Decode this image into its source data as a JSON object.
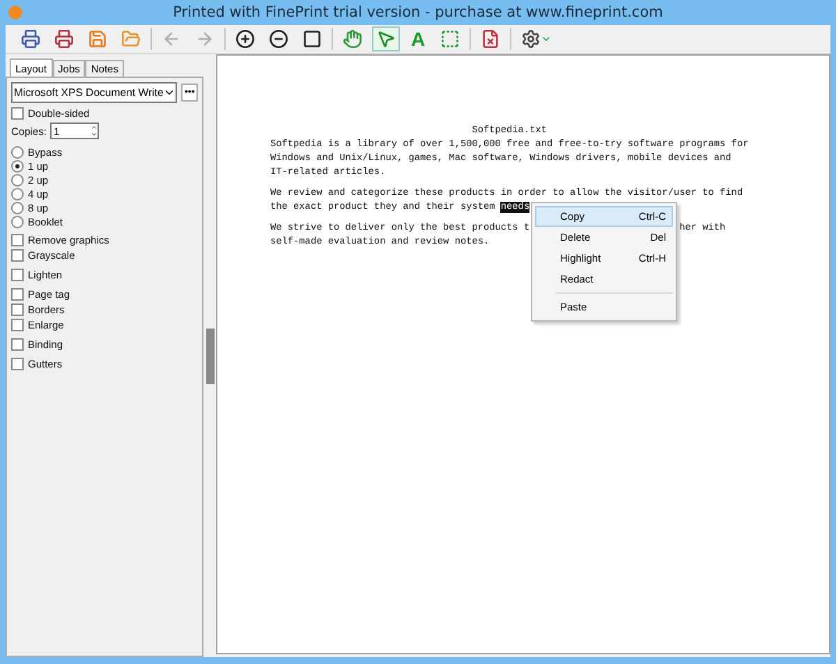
{
  "window": {
    "title": "Printed with FinePrint trial version - purchase at www.fineprint.com"
  },
  "toolbar": [
    {
      "kind": "print",
      "disabled": false,
      "selected": false
    },
    {
      "kind": "print-cancel",
      "disabled": false,
      "selected": false
    },
    {
      "kind": "save",
      "disabled": false,
      "selected": false
    },
    {
      "kind": "open",
      "disabled": false,
      "selected": false
    },
    {
      "kind": "back",
      "disabled": true,
      "selected": false
    },
    {
      "kind": "forward",
      "disabled": true,
      "selected": false
    },
    {
      "kind": "zoom-in",
      "disabled": false,
      "selected": false
    },
    {
      "kind": "zoom-out",
      "disabled": false,
      "selected": false
    },
    {
      "kind": "fit",
      "disabled": false,
      "selected": false
    },
    {
      "kind": "hand",
      "disabled": false,
      "selected": false
    },
    {
      "kind": "pointer",
      "disabled": false,
      "selected": true
    },
    {
      "kind": "text",
      "label": "A",
      "disabled": false,
      "selected": false
    },
    {
      "kind": "marquee",
      "disabled": false,
      "selected": false
    },
    {
      "kind": "delete-page",
      "disabled": false,
      "selected": false
    },
    {
      "kind": "settings",
      "disabled": false,
      "selected": false
    }
  ],
  "tabs": [
    {
      "label": "Layout",
      "selected": true
    },
    {
      "label": "Jobs",
      "selected": false
    },
    {
      "label": "Notes",
      "selected": false
    }
  ],
  "printer": {
    "value": "Microsoft XPS Document Write",
    "more": "•••"
  },
  "double_sided": {
    "label": "Double-sided",
    "checked": false
  },
  "copies": {
    "label": "Copies:",
    "value": "1"
  },
  "option_groups": [
    [
      {
        "kind": "radio",
        "label": "Bypass",
        "selected": false
      },
      {
        "kind": "radio",
        "label": "1 up",
        "selected": true
      },
      {
        "kind": "radio",
        "label": "2 up",
        "selected": false
      },
      {
        "kind": "radio",
        "label": "4 up",
        "selected": false
      },
      {
        "kind": "radio",
        "label": "8 up",
        "selected": false
      },
      {
        "kind": "radio",
        "label": "Booklet",
        "selected": false
      }
    ],
    [
      {
        "kind": "checkbox",
        "label": "Remove graphics",
        "checked": false
      },
      {
        "kind": "checkbox",
        "label": "Grayscale",
        "checked": false
      }
    ],
    [
      {
        "kind": "checkbox",
        "label": "Lighten",
        "checked": false
      }
    ],
    [
      {
        "kind": "checkbox",
        "label": "Page tag",
        "checked": false
      },
      {
        "kind": "checkbox",
        "label": "Borders",
        "checked": false
      },
      {
        "kind": "checkbox",
        "label": "Enlarge",
        "checked": false
      }
    ],
    [
      {
        "kind": "checkbox",
        "label": "Binding",
        "checked": false
      }
    ],
    [
      {
        "kind": "checkbox",
        "label": "Gutters",
        "checked": false
      }
    ]
  ],
  "document": {
    "title": "Softpedia.txt",
    "paragraphs": [
      [
        "Softpedia is a library of over 1,500,000 free and free-to-try software programs for",
        "Windows and Unix/Linux, games, Mac software, Windows drivers, mobile devices and",
        "IT-related articles."
      ],
      [
        "We review and categorize these products in order to allow the visitor/user to find",
        "the exact product they and their system **needs**"
      ],
      [
        "We strive to deliver only the best products t",
        "her with",
        "self-made evaluation and review notes."
      ]
    ]
  },
  "context_menu": [
    {
      "kind": "item",
      "label": "Copy",
      "shortcut": "Ctrl-C",
      "selected": true
    },
    {
      "kind": "item",
      "label": "Delete",
      "shortcut": "Del",
      "selected": false
    },
    {
      "kind": "item",
      "label": "Highlight",
      "shortcut": "Ctrl-H",
      "selected": false
    },
    {
      "kind": "item",
      "label": "Redact",
      "selected": false
    },
    {
      "kind": "separator"
    },
    {
      "kind": "item",
      "label": "Paste",
      "selected": false
    }
  ]
}
